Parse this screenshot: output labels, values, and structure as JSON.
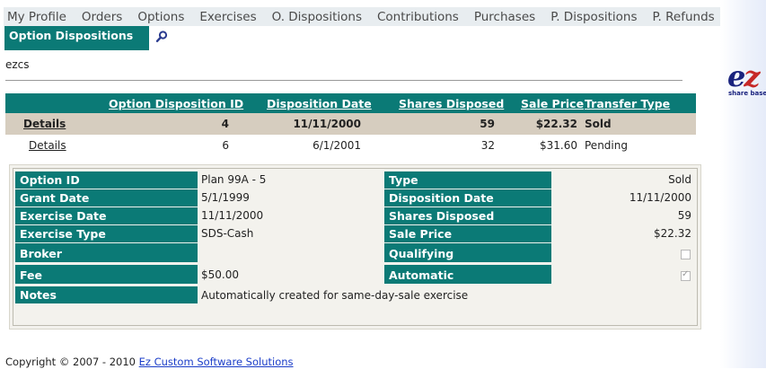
{
  "nav": [
    "My Profile",
    "Orders",
    "Options",
    "Exercises",
    "O. Dispositions",
    "Contributions",
    "Purchases",
    "P. Dispositions",
    "P. Refunds"
  ],
  "page_title": "Option Dispositions",
  "icons": {
    "search": "search-icon",
    "logo": "ez-logo"
  },
  "logo": {
    "text_e": "e",
    "text_z": "z",
    "tagline": "share base"
  },
  "user": "ezcs",
  "colors": {
    "accent": "#0b7a76",
    "selected_row": "#d6cdbf",
    "nav_bg": "#e8edf0",
    "link": "#1a3cc8"
  },
  "grid": {
    "headers": [
      "Option Disposition ID",
      "Disposition Date",
      "Shares Disposed",
      "Sale Price",
      "Transfer Type"
    ],
    "rows": [
      {
        "link": "Details",
        "id": "4",
        "date": "11/11/2000",
        "shares": "59",
        "price": "$22.32",
        "type": "Sold",
        "selected": true
      },
      {
        "link": "Details",
        "id": "6",
        "date": "6/1/2001",
        "shares": "32",
        "price": "$31.60",
        "type": "Pending",
        "selected": false
      }
    ]
  },
  "detail": {
    "left": [
      {
        "label": "Option ID",
        "value": "Plan 99A - 5"
      },
      {
        "label": "Grant Date",
        "value": "5/1/1999"
      },
      {
        "label": "Exercise Date",
        "value": "11/11/2000"
      },
      {
        "label": "Exercise Type",
        "value": "SDS-Cash"
      },
      {
        "label": "Broker",
        "value": ""
      },
      {
        "label": "Fee",
        "value": "$50.00"
      },
      {
        "label": "Notes",
        "value": "Automatically created for same-day-sale exercise"
      }
    ],
    "right": [
      {
        "label": "Type",
        "value": "Sold"
      },
      {
        "label": "Disposition Date",
        "value": "11/11/2000"
      },
      {
        "label": "Shares Disposed",
        "value": "59"
      },
      {
        "label": "Sale Price",
        "value": "$22.32"
      },
      {
        "label": "Qualifying",
        "checked": false
      },
      {
        "label": "Automatic",
        "checked": true
      }
    ]
  },
  "footer": {
    "text": "Copyright © 2007 - 2010 ",
    "link": "Ez Custom Software Solutions"
  }
}
